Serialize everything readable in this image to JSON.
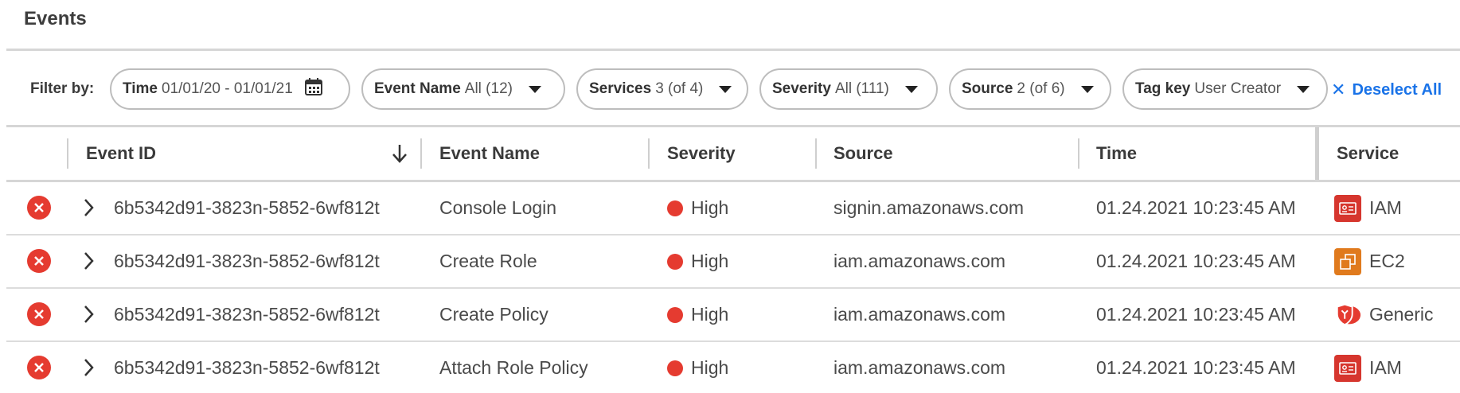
{
  "page": {
    "title": "Events"
  },
  "filters": {
    "label": "Filter by:",
    "items": [
      {
        "key": "Time",
        "value": "01/01/20 - 01/01/21",
        "icon": "calendar-icon"
      },
      {
        "key": "Event Name",
        "value": "All (12)",
        "icon": "caret-down-icon"
      },
      {
        "key": "Services",
        "value": "3 (of 4)",
        "icon": "caret-down-icon"
      },
      {
        "key": "Severity",
        "value": "All (111)",
        "icon": "caret-down-icon"
      },
      {
        "key": "Source",
        "value": "2 (of 6)",
        "icon": "caret-down-icon"
      },
      {
        "key": "Tag key",
        "value": "User Creator",
        "icon": "caret-down-icon"
      }
    ],
    "deselect_label": "Deselect All"
  },
  "table": {
    "columns": [
      "Event ID",
      "Event Name",
      "Severity",
      "Source",
      "Time",
      "Service"
    ],
    "sort_icon": "arrow-down-icon",
    "rows": [
      {
        "event_id": "6b5342d91-3823n-5852-6wf812t",
        "event_name": "Console Login",
        "severity": "High",
        "source": "signin.amazonaws.com",
        "time": "01.24.2021 10:23:45 AM",
        "service": "IAM",
        "service_icon": "iam-icon"
      },
      {
        "event_id": "6b5342d91-3823n-5852-6wf812t",
        "event_name": "Create Role",
        "severity": "High",
        "source": "iam.amazonaws.com",
        "time": "01.24.2021 10:23:45 AM",
        "service": "EC2",
        "service_icon": "ec2-icon"
      },
      {
        "event_id": "6b5342d91-3823n-5852-6wf812t",
        "event_name": "Create Policy",
        "severity": "High",
        "source": "iam.amazonaws.com",
        "time": "01.24.2021 10:23:45 AM",
        "service": "Generic",
        "service_icon": "shield-icon"
      },
      {
        "event_id": "6b5342d91-3823n-5852-6wf812t",
        "event_name": "Attach Role Policy",
        "severity": "High",
        "source": "iam.amazonaws.com",
        "time": "01.24.2021 10:23:45 AM",
        "service": "IAM",
        "service_icon": "iam-icon"
      }
    ]
  },
  "colors": {
    "severity_high": "#e53b30",
    "link": "#1a73e8",
    "iam": "#d6362e",
    "ec2": "#e07a1d"
  }
}
